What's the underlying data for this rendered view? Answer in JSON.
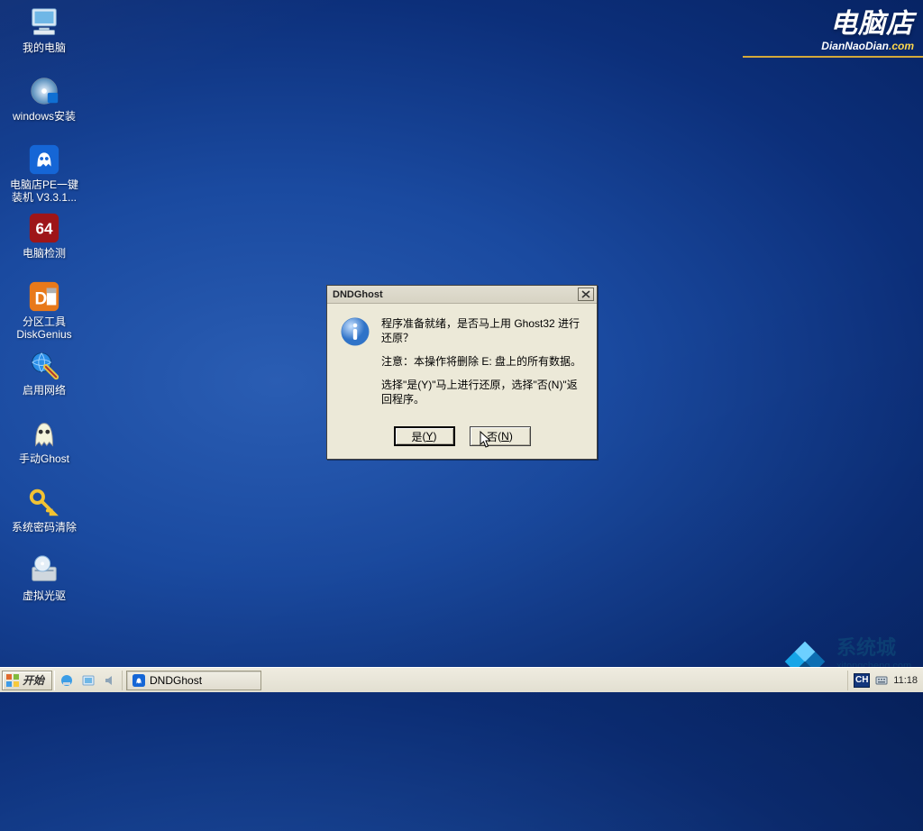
{
  "brand": {
    "cn": "电脑店",
    "en_prefix": "DianNaoDian",
    "en_suffix": ".com"
  },
  "desktop_icons": [
    {
      "id": "my-computer",
      "label": "我的电脑",
      "icon": "monitor"
    },
    {
      "id": "windows-install",
      "label": "windows安装",
      "icon": "disc"
    },
    {
      "id": "dnd-pe-onekey",
      "label": "电脑店PE一键装机 V3.3.1...",
      "icon": "ghost-blue"
    },
    {
      "id": "pc-detect",
      "label": "电脑检测",
      "icon": "sixtyfour"
    },
    {
      "id": "disk-genius",
      "label": "分区工具DiskGenius",
      "icon": "diskgenius"
    },
    {
      "id": "enable-network",
      "label": "启用网络",
      "icon": "globe-net"
    },
    {
      "id": "manual-ghost",
      "label": "手动Ghost",
      "icon": "ghost-white"
    },
    {
      "id": "clear-password",
      "label": "系统密码清除",
      "icon": "key"
    },
    {
      "id": "virtual-drive",
      "label": "虚拟光驱",
      "icon": "opt-drive"
    }
  ],
  "dialog": {
    "title": "DNDGhost",
    "line1": "程序准备就绪，是否马上用 Ghost32 进行还原？",
    "line2": "注意：本操作将删除 E: 盘上的所有数据。",
    "line3": "选择\"是(Y)\"马上进行还原，选择\"否(N)\"返回程序。",
    "yes_label": "是",
    "yes_accel": "Y",
    "no_label": "否",
    "no_accel": "N"
  },
  "taskbar": {
    "start_label": "开始",
    "task_item_label": "DNDGhost",
    "lang": "CH",
    "clock": "11:18"
  },
  "watermark": {
    "text_cn": "系统城",
    "url": "xitongcheng.com"
  },
  "colors": {
    "accent_yellow": "#d4a93a",
    "dialog_bg": "#ece9d8",
    "lang_bg": "#14377c"
  }
}
